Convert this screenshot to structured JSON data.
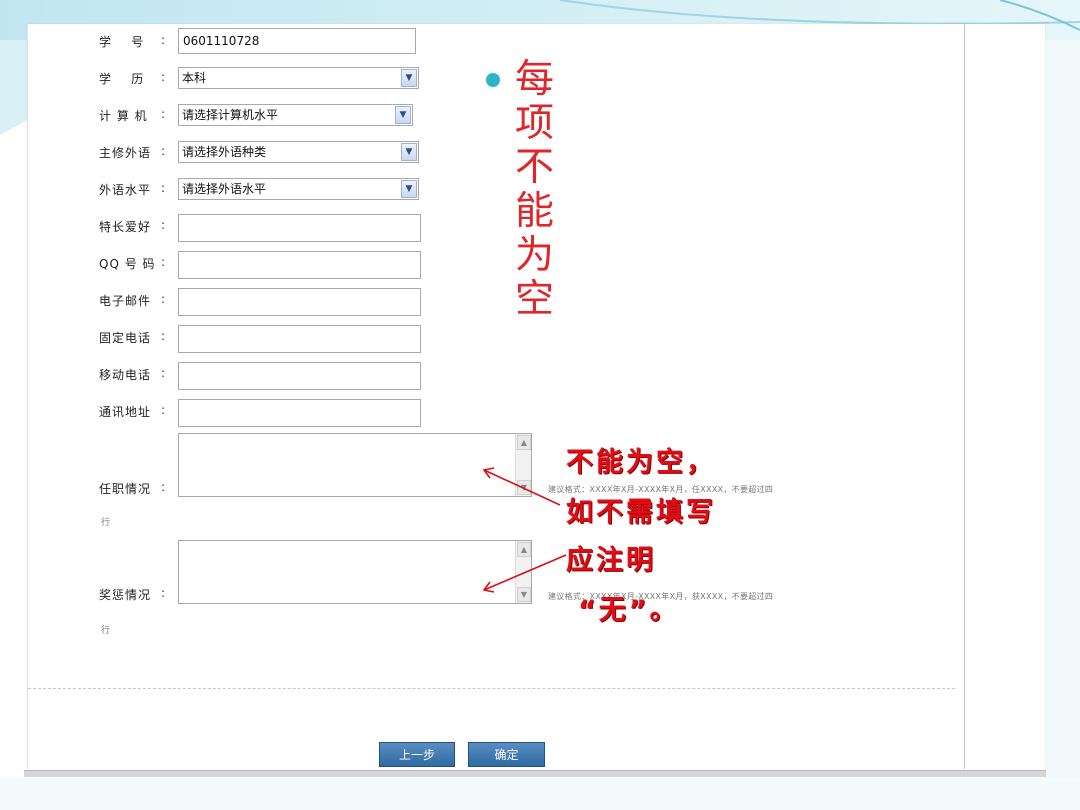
{
  "form": {
    "fields": [
      {
        "label": "学    号",
        "value": "0601110728"
      },
      {
        "label": "学    历",
        "selected": "本科"
      },
      {
        "label": "计 算 机",
        "selected": "请选择计算机水平"
      },
      {
        "label": "主修外语",
        "selected": "请选择外语种类"
      },
      {
        "label": "外语水平",
        "selected": "请选择外语水平"
      },
      {
        "label": "特长爱好",
        "value": ""
      },
      {
        "label": "QQ 号 码",
        "value": ""
      },
      {
        "label": "电子邮件",
        "value": ""
      },
      {
        "label": "固定电话",
        "value": ""
      },
      {
        "label": "移动电话",
        "value": ""
      },
      {
        "label": "通讯地址",
        "value": ""
      }
    ],
    "colon": ":",
    "job": {
      "label": "任职情况",
      "hint": "建议格式：XXXX年X月-XXXX年X月，任XXXX，不要超过四",
      "tail": "行"
    },
    "award": {
      "label": "奖惩情况",
      "hint": "建议格式：XXXX年X月-XXXX年X月，获XXXX，不要超过四",
      "tail": "行"
    },
    "buttons": {
      "prev": "上一步",
      "ok": "确定"
    }
  },
  "annotations": {
    "vertical_note": [
      "每",
      "项",
      "不",
      "能",
      "为",
      "空"
    ],
    "callout_lines": [
      "不能为空，",
      "如不需填写",
      "应注明",
      "“无”。"
    ]
  },
  "colors": {
    "accent_red": "#e00d16",
    "bullet_teal": "#2bb6c4",
    "button_blue": "#2f6aa3"
  }
}
